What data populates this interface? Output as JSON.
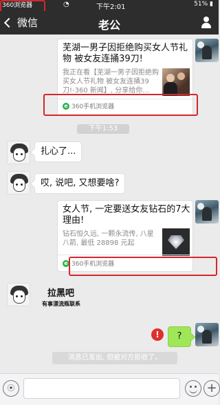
{
  "status_bar": {
    "source_app": "360浏览器",
    "time": "下午2:01",
    "battery": "51%",
    "signal_icon": "signal-icon",
    "wifi_icon": "wifi-icon"
  },
  "nav": {
    "back_label": "微信",
    "title": "老公",
    "profile_icon": "person-icon"
  },
  "messages": {
    "card1": {
      "title": "芜湖一男子因拒绝购买女人节礼物 被女友连捅39刀!",
      "desc": "我正在看【芜湖一男子因拒绝购买女人节礼物 被女友连捅39刀!-360 新闻】, 分享给你...",
      "source": "360手机浏览器"
    },
    "timestamp": "下午1:53",
    "bubble1": "扎心了...",
    "bubble2": "哎, 说吧, 又想要啥?",
    "card2": {
      "title": "女人节, 一定要送女友钻石的7大理由!",
      "desc": "钻石恒久远, 一颗永流传, 八星八箭, 最低 28898 元起",
      "source": "360手机浏览器"
    },
    "pull_black": {
      "title": "拉黑吧",
      "subtitle": "有事漂流瓶联系"
    },
    "sent": "?",
    "error_mark": "!",
    "rejected_notice": "消息已发出, 但被对方拒收了。"
  },
  "colors": {
    "nav_bg": "#2d2d2d",
    "highlight": "#d4262c",
    "sent_bubble": "#9fe658",
    "error": "#e0302c"
  }
}
